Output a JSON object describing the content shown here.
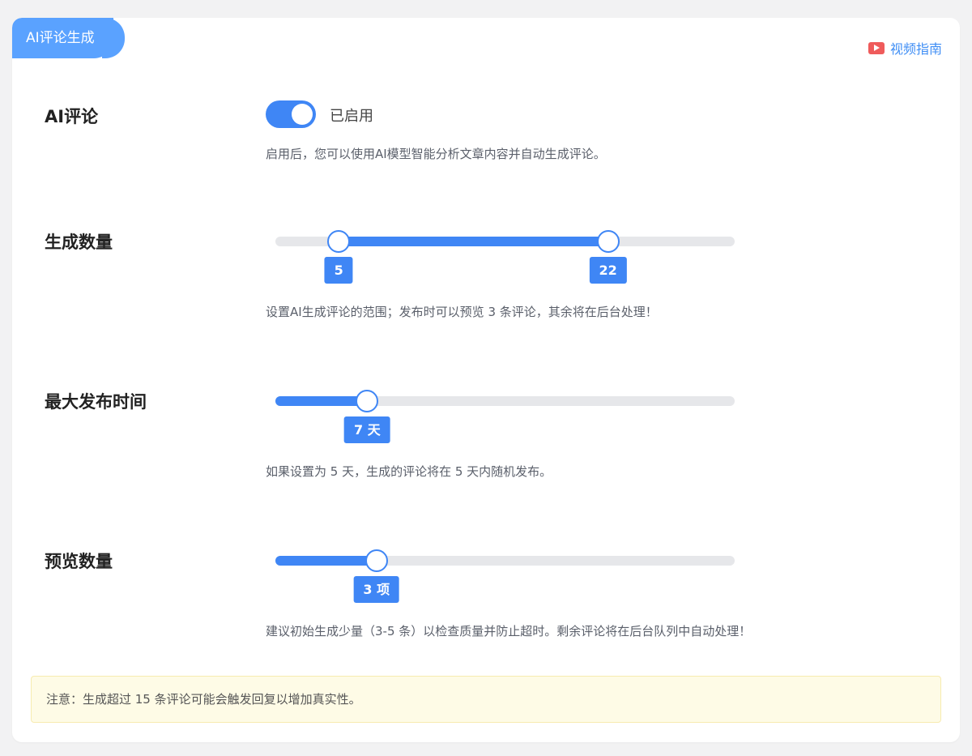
{
  "header": {
    "tab_title": "AI评论生成",
    "video_guide_label": "视频指南"
  },
  "ai_comment": {
    "label": "AI评论",
    "toggle_on": true,
    "status_text": "已启用",
    "description": "启用后，您可以使用AI模型智能分析文章内容并自动生成评论。"
  },
  "generate_count": {
    "label": "生成数量",
    "min_value": 5,
    "max_value": 22,
    "min_tip": "5",
    "max_tip": "22",
    "description": "设置AI生成评论的范围；发布时可以预览 3 条评论，其余将在后台处理！"
  },
  "max_publish_time": {
    "label": "最大发布时间",
    "value_fraction": 0.2,
    "tip": "7 天",
    "description": "如果设置为 5 天，生成的评论将在 5 天内随机发布。"
  },
  "preview_count": {
    "label": "预览数量",
    "value_fraction": 0.22,
    "tip": "3 项",
    "description": "建议初始生成少量（3-5 条）以检查质量并防止超时。剩余评论将在后台队列中自动处理！"
  },
  "notice": {
    "text": "注意：生成超过 15 条评论可能会触发回复以增加真实性。"
  },
  "colors": {
    "accent": "#3f86f5",
    "tab": "#5aa2ff",
    "video_icon": "#ef5b5b",
    "notice_bg": "#fefbe6"
  }
}
